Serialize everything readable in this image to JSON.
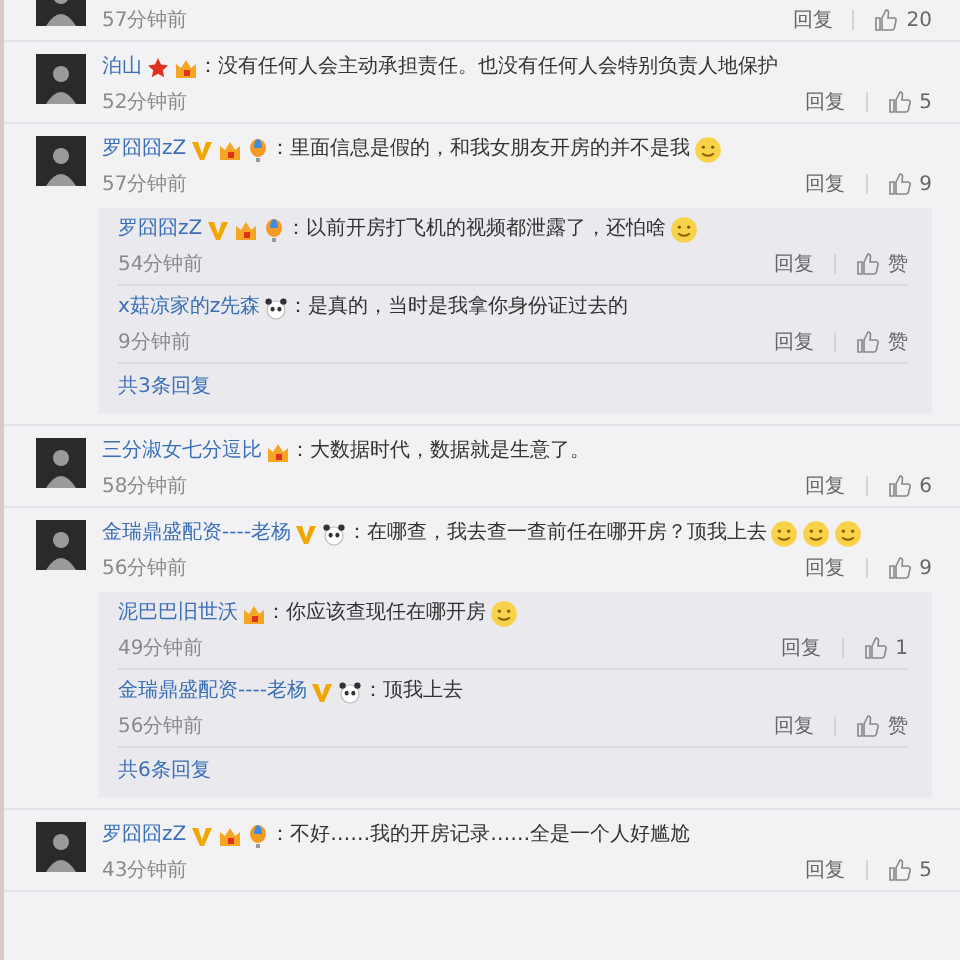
{
  "comments": [
    {
      "time": "57分钟前",
      "reply_label": "回复",
      "likes": "20"
    },
    {
      "name": "泊山",
      "badges": [
        {
          "kind": "star"
        },
        {
          "kind": "level"
        }
      ],
      "text": "：没有任何人会主动承担责任。也没有任何人会特别负责人地保护",
      "time": "52分钟前",
      "reply_label": "回复",
      "likes": "5"
    },
    {
      "name": "罗囧囧zZ",
      "badges": [
        {
          "kind": "vip"
        },
        {
          "kind": "level"
        },
        {
          "kind": "balloon"
        }
      ],
      "text": "：里面信息是假的，和我女朋友开房的并不是我",
      "emojis": [
        {
          "kind": "face"
        }
      ],
      "time": "57分钟前",
      "reply_label": "回复",
      "likes": "9",
      "replies": [
        {
          "name": "罗囧囧zZ",
          "badges": [
            {
              "kind": "vip"
            },
            {
              "kind": "level"
            },
            {
              "kind": "balloon"
            }
          ],
          "text": "：以前开房打飞机的视频都泄露了，还怕啥",
          "emojis": [
            {
              "kind": "face"
            }
          ],
          "time": "54分钟前",
          "reply_label": "回复",
          "likes": "赞"
        },
        {
          "name": "x菇凉家的z先森",
          "badges": [
            {
              "kind": "panda"
            }
          ],
          "text": "：是真的，当时是我拿你身份证过去的",
          "time": "9分钟前",
          "reply_label": "回复",
          "likes": "赞"
        }
      ],
      "more": "共3条回复"
    },
    {
      "name": "三分淑女七分逗比",
      "badges": [
        {
          "kind": "level"
        }
      ],
      "text": "：大数据时代，数据就是生意了。",
      "time": "58分钟前",
      "reply_label": "回复",
      "likes": "6"
    },
    {
      "name": "金瑞鼎盛配资----老杨",
      "badges": [
        {
          "kind": "vip"
        },
        {
          "kind": "panda"
        }
      ],
      "text": "：在哪查，我去查一查前任在哪开房？顶我上去",
      "emojis": [
        {
          "kind": "face"
        },
        {
          "kind": "face"
        },
        {
          "kind": "face"
        }
      ],
      "time": "56分钟前",
      "reply_label": "回复",
      "likes": "9",
      "replies": [
        {
          "name": "泥巴巴旧世沃",
          "badges": [
            {
              "kind": "level"
            }
          ],
          "text": "：你应该查现任在哪开房",
          "emojis": [
            {
              "kind": "face"
            }
          ],
          "time": "49分钟前",
          "reply_label": "回复",
          "likes": "1"
        },
        {
          "name": "金瑞鼎盛配资----老杨",
          "badges": [
            {
              "kind": "vip"
            },
            {
              "kind": "panda"
            }
          ],
          "text": "：顶我上去",
          "time": "56分钟前",
          "reply_label": "回复",
          "likes": "赞"
        }
      ],
      "more": "共6条回复"
    },
    {
      "name": "罗囧囧zZ",
      "badges": [
        {
          "kind": "vip"
        },
        {
          "kind": "level"
        },
        {
          "kind": "balloon"
        }
      ],
      "text": "：不好……我的开房记录……全是一个人好尴尬",
      "time": "43分钟前",
      "reply_label": "回复",
      "likes": "5"
    }
  ]
}
